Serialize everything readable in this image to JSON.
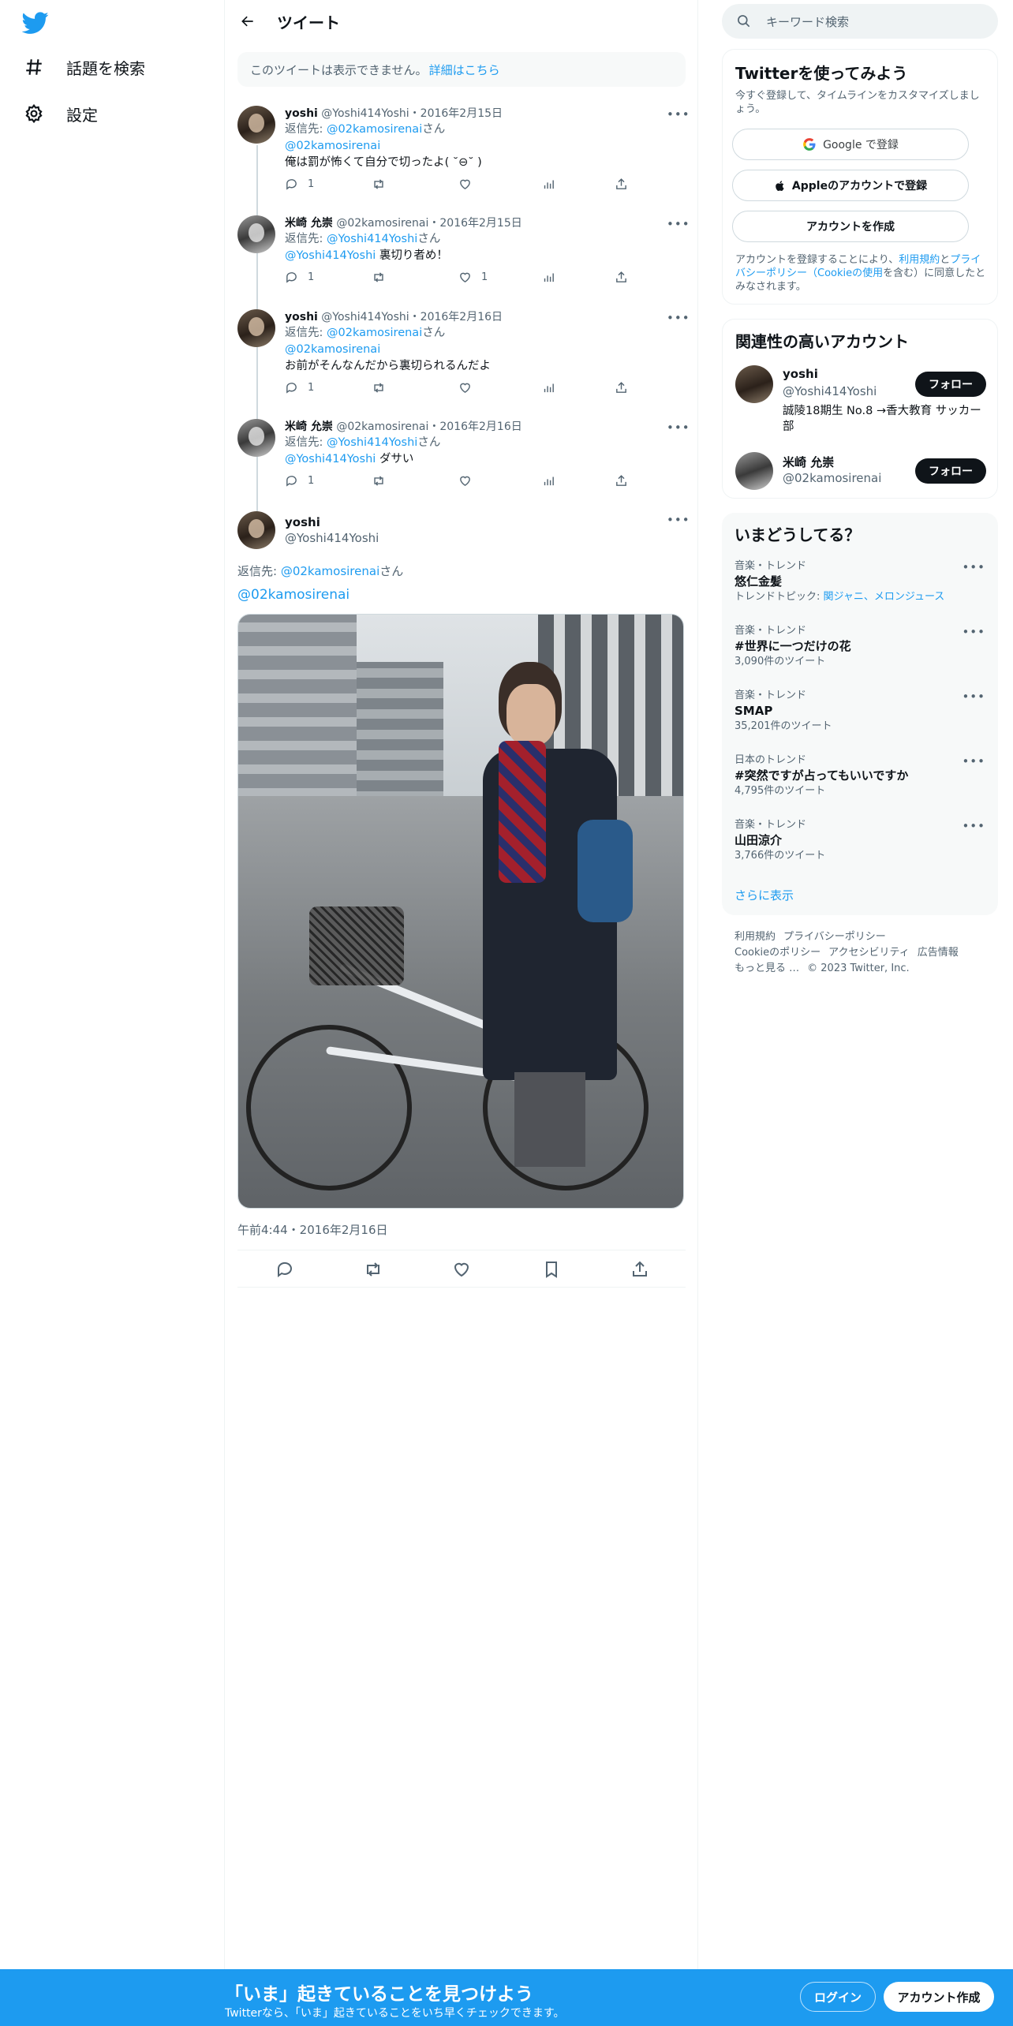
{
  "nav": {
    "explore_label": "話題を検索",
    "settings_label": "設定"
  },
  "header": {
    "title": "ツイート"
  },
  "notice": {
    "text": "このツイートは表示できません。",
    "link": "詳細はこちら"
  },
  "replies": [
    {
      "name": "yoshi",
      "handle": "@Yoshi414Yoshi",
      "date": "2016年2月15日",
      "reply_to_prefix": "返信先: ",
      "reply_to": "@02kamosirenai",
      "reply_suffix": "さん",
      "mention": "@02kamosirenai",
      "text": "俺は罰が怖くて自分で切ったよ( ˘⊖˘ )",
      "text_inline": "",
      "replies": "1",
      "retweets": "",
      "likes": ""
    },
    {
      "name": "米崎 允崇",
      "handle": "@02kamosirenai",
      "date": "2016年2月15日",
      "reply_to_prefix": "返信先: ",
      "reply_to": "@Yoshi414Yoshi",
      "reply_suffix": "さん",
      "mention": "@Yoshi414Yoshi",
      "text": "",
      "text_inline": " 裏切り者め！",
      "replies": "1",
      "retweets": "",
      "likes": "1"
    },
    {
      "name": "yoshi",
      "handle": "@Yoshi414Yoshi",
      "date": "2016年2月16日",
      "reply_to_prefix": "返信先: ",
      "reply_to": "@02kamosirenai",
      "reply_suffix": "さん",
      "mention": "@02kamosirenai",
      "text": "お前がそんなんだから裏切られるんだよ",
      "text_inline": "",
      "replies": "1",
      "retweets": "",
      "likes": ""
    },
    {
      "name": "米崎 允崇",
      "handle": "@02kamosirenai",
      "date": "2016年2月16日",
      "reply_to_prefix": "返信先: ",
      "reply_to": "@Yoshi414Yoshi",
      "reply_suffix": "さん",
      "mention": "@Yoshi414Yoshi",
      "text": "",
      "text_inline": " ダサい",
      "replies": "1",
      "retweets": "",
      "likes": ""
    }
  ],
  "main_tweet": {
    "name": "yoshi",
    "handle": "@Yoshi414Yoshi",
    "reply_to_prefix": "返信先: ",
    "reply_to": "@02kamosirenai",
    "reply_suffix": "さん",
    "text": "@02kamosirenai",
    "timestamp": "午前4:44・2016年2月16日"
  },
  "search": {
    "placeholder": "キーワード検索"
  },
  "signup_card": {
    "title": "Twitterを使ってみよう",
    "subtitle": "今すぐ登録して、タイムラインをカスタマイズしましょう。",
    "google_label": "Google で登録",
    "apple_label": "Appleのアカウントで登録",
    "create_label": "アカウントを作成",
    "terms_prefix": "アカウントを登録することにより、",
    "terms_link": "利用規約",
    "terms_and": "と",
    "privacy_link": "プライバシーポリシー",
    "cookie_link": "（Cookieの使用",
    "terms_suffix": "を含む）に同意したとみなされます。"
  },
  "related": {
    "title": "関連性の高いアカウント",
    "accounts": [
      {
        "name": "yoshi",
        "handle": "@Yoshi414Yoshi",
        "bio": "誠陵18期生 No.8 →香大教育 サッカー部",
        "follow": "フォロー"
      },
      {
        "name": "米崎 允崇",
        "handle": "@02kamosirenai",
        "bio": "",
        "follow": "フォロー"
      }
    ]
  },
  "trends": {
    "title": "いまどうしてる？",
    "items": [
      {
        "category": "音楽・トレンド",
        "title": "悠仁金髪",
        "sub_prefix": "トレンドトピック: ",
        "sub_link": "関ジャニ、メロンジュース",
        "count": ""
      },
      {
        "category": "音楽・トレンド",
        "title": "#世界に一つだけの花",
        "sub_prefix": "",
        "sub_link": "",
        "count": "3,090件のツイート"
      },
      {
        "category": "音楽・トレンド",
        "title": "SMAP",
        "sub_prefix": "",
        "sub_link": "",
        "count": "35,201件のツイート"
      },
      {
        "category": "日本のトレンド",
        "title": "#突然ですが占ってもいいですか",
        "sub_prefix": "",
        "sub_link": "",
        "count": "4,795件のツイート"
      },
      {
        "category": "音楽・トレンド",
        "title": "山田涼介",
        "sub_prefix": "",
        "sub_link": "",
        "count": "3,766件のツイート"
      }
    ],
    "show_more": "さらに表示"
  },
  "footer": {
    "links": [
      "利用規約",
      "プライバシーポリシー",
      "Cookieのポリシー",
      "アクセシビリティ",
      "広告情報",
      "もっと見る …"
    ],
    "copyright": "© 2023 Twitter, Inc."
  },
  "bottom_bar": {
    "title": "「いま」起きていることを見つけよう",
    "subtitle": "Twitterなら、「いま」起きていることをいち早くチェックできます。",
    "login": "ログイン",
    "signup": "アカウント作成"
  },
  "colors": {
    "accent": "#1d9bf0",
    "text": "#0f1419",
    "muted": "#536471",
    "border": "#eff3f4"
  },
  "icons": [
    "twitter-logo-icon",
    "hashtag-icon",
    "gear-icon",
    "back-arrow-icon",
    "search-icon",
    "reply-icon",
    "retweet-icon",
    "like-icon",
    "analytics-icon",
    "share-icon",
    "bookmark-icon",
    "more-icon",
    "google-icon",
    "apple-icon"
  ]
}
